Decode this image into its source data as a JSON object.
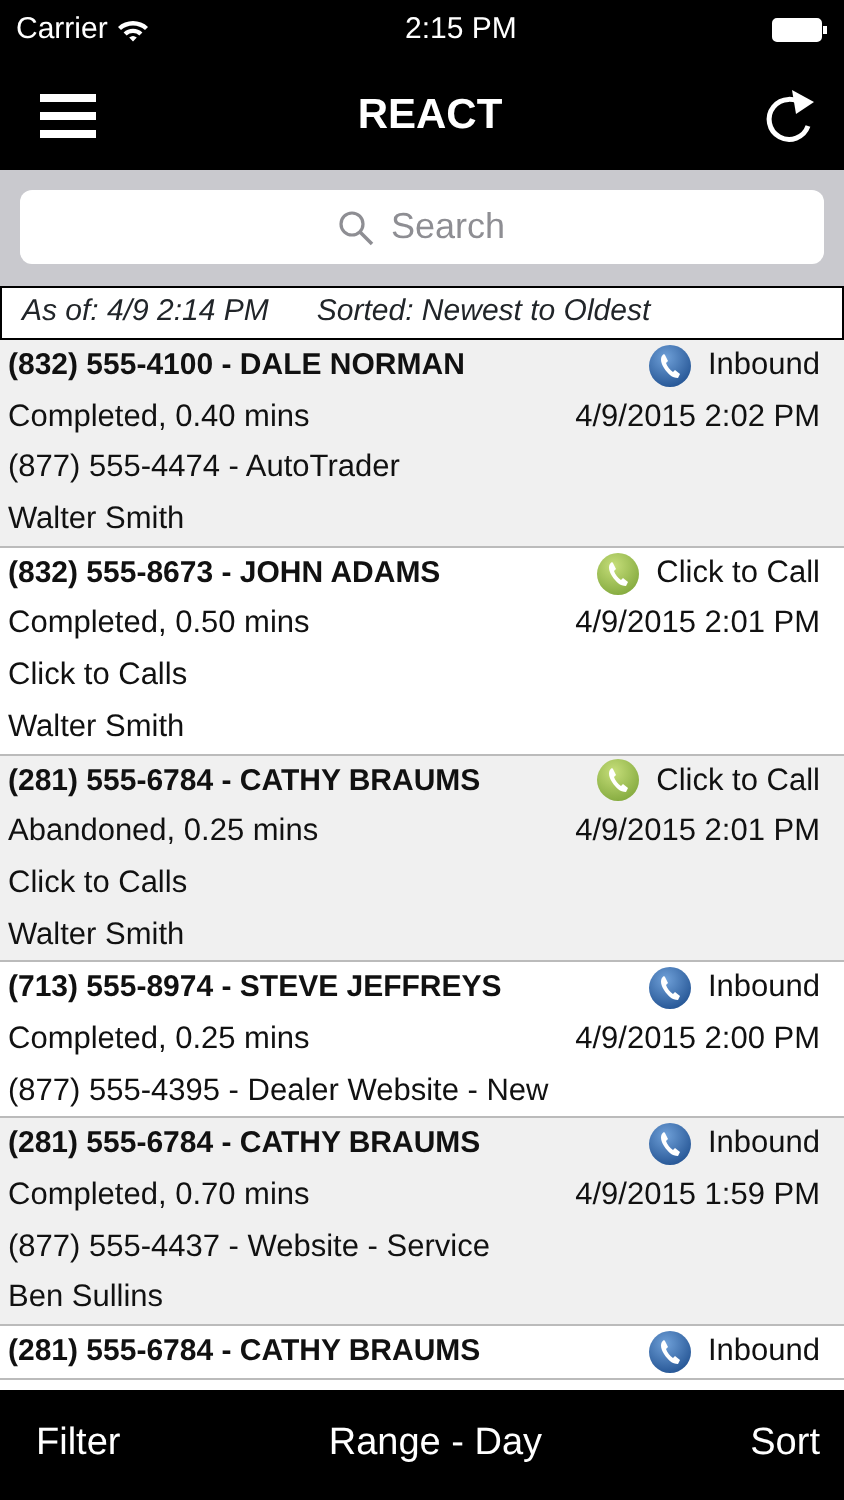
{
  "status_bar": {
    "carrier": "Carrier",
    "time": "2:15 PM"
  },
  "nav": {
    "title": "REACT"
  },
  "search": {
    "placeholder": "Search"
  },
  "info": {
    "as_of": "As of: 4/9 2:14 PM",
    "sorted": "Sorted: Newest to Oldest"
  },
  "calls": [
    {
      "caller": "(832) 555-4100 - DALE NORMAN",
      "kind": "inbound",
      "type": "Inbound",
      "result": "Completed, 0.40 mins",
      "date": "4/9/2015 2:02 PM",
      "source": "(877) 555-4474 - AutoTrader",
      "agent": "Walter Smith"
    },
    {
      "caller": "(832) 555-8673 - JOHN ADAMS",
      "kind": "click",
      "type": "Click to Call",
      "result": "Completed, 0.50 mins",
      "date": "4/9/2015 2:01 PM",
      "source": "Click to Calls",
      "agent": "Walter Smith"
    },
    {
      "caller": "(281) 555-6784 - CATHY BRAUMS",
      "kind": "click",
      "type": "Click to Call",
      "result": "Abandoned, 0.25 mins",
      "date": "4/9/2015 2:01 PM",
      "source": "Click to Calls",
      "agent": "Walter Smith"
    },
    {
      "caller": "(713) 555-8974 - STEVE JEFFREYS",
      "kind": "inbound",
      "type": "Inbound",
      "result": "Completed, 0.25 mins",
      "date": "4/9/2015 2:00 PM",
      "source": "(877) 555-4395 - Dealer Website - New"
    },
    {
      "caller": "(281) 555-6784 - CATHY BRAUMS",
      "kind": "inbound",
      "type": "Inbound",
      "result": "Completed, 0.70 mins",
      "date": "4/9/2015 1:59 PM",
      "source": "(877) 555-4437 - Website - Service",
      "agent": "Ben Sullins"
    },
    {
      "caller": "(281) 555-6784 - CATHY BRAUMS",
      "kind": "inbound",
      "type": "Inbound"
    }
  ],
  "tab_bar": [
    "Filter",
    "Range - Day",
    "Sort"
  ]
}
